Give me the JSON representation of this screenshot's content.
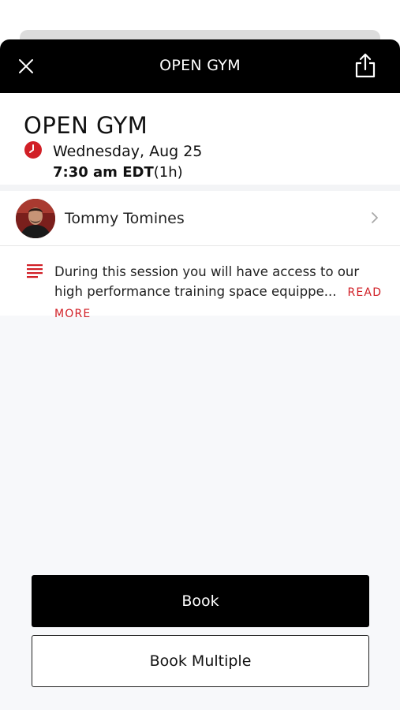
{
  "header": {
    "title": "OPEN GYM"
  },
  "session": {
    "name": "OPEN GYM",
    "date": "Wednesday, Aug 25",
    "time": "7:30 am EDT",
    "duration": "(1h)"
  },
  "instructor": {
    "name": "Tommy Tomines"
  },
  "description": {
    "text": "During this session you will have access to our high performance training space equippe...",
    "read_more": "READ MORE"
  },
  "buttons": {
    "book": "Book",
    "book_multiple": "Book Multiple"
  },
  "colors": {
    "accent": "#d11f26",
    "header_bg": "#000000",
    "background": "#f7f8fa"
  },
  "icons": [
    "close-icon",
    "share-icon",
    "clock-icon",
    "chevron-right-icon",
    "description-lines-icon"
  ]
}
